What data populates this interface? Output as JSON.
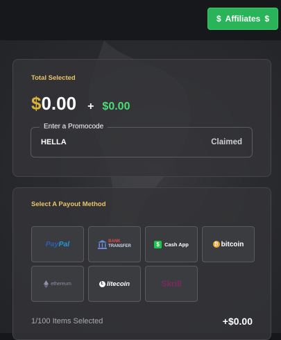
{
  "header": {
    "affiliates_label": "Affiliates",
    "dollar_icon_left": "$",
    "dollar_icon_right": "$"
  },
  "total_card": {
    "title": "Total Selected",
    "currency_symbol": "$",
    "amount": "0.00",
    "plus": "+",
    "bonus": "$0.00",
    "promo": {
      "label": "Enter a Promocode",
      "value": "HELLA",
      "status": "Claimed"
    }
  },
  "payout_card": {
    "title": "Select A Payout Method",
    "methods": [
      {
        "name": "paypal",
        "label_a": "Pay",
        "label_b": "Pal"
      },
      {
        "name": "bank-transfer",
        "label_a": "BANK",
        "label_b": "TRANSFER"
      },
      {
        "name": "cash-app",
        "badge": "$",
        "label": "Cash App"
      },
      {
        "name": "bitcoin",
        "badge": "₿",
        "label": "bitcoin"
      },
      {
        "name": "ethereum",
        "label": "ethereum"
      },
      {
        "name": "litecoin",
        "badge": "Ł",
        "label": "litecoin"
      },
      {
        "name": "skrill",
        "label": "Skrill"
      }
    ],
    "items_selected": "1/100 Items Selected",
    "total": "+$0.00"
  },
  "colors": {
    "accent_gold": "#e9c46a",
    "affiliates_green": "#2ab45a",
    "bonus_green": "#4ddb77"
  }
}
